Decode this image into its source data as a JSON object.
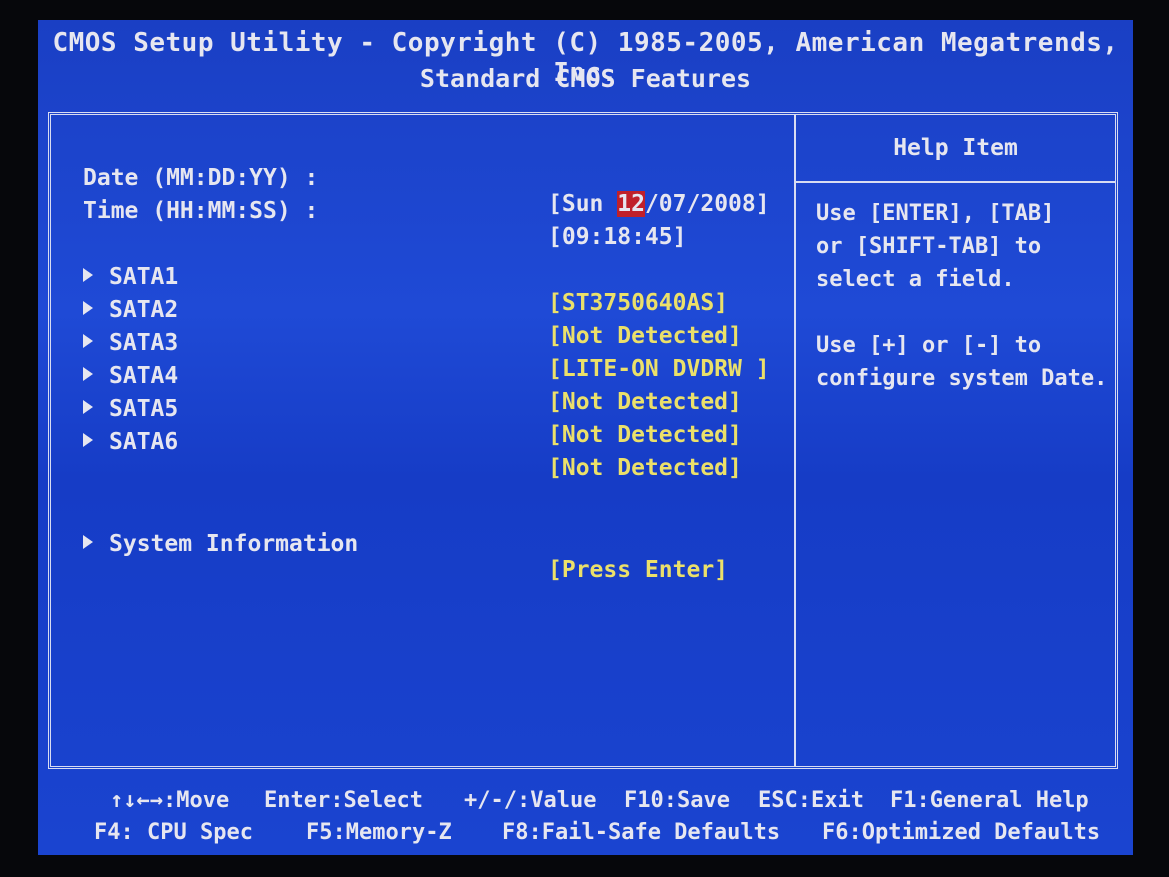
{
  "header": {
    "title": "CMOS Setup Utility - Copyright (C) 1985-2005, American Megatrends, Inc.",
    "subtitle": "Standard CMOS Features"
  },
  "fields": {
    "date": {
      "label": "Date (MM:DD:YY) :",
      "prefix": "[Sun ",
      "selected": "12",
      "suffix": "/07/2008]"
    },
    "time": {
      "label": "Time (HH:MM:SS) :",
      "value": "[09:18:45]"
    },
    "sata": [
      {
        "label": "SATA1",
        "value": "[ST3750640AS]"
      },
      {
        "label": "SATA2",
        "value": "[Not Detected]"
      },
      {
        "label": "SATA3",
        "value": "[LITE-ON DVDRW ]"
      },
      {
        "label": "SATA4",
        "value": "[Not Detected]"
      },
      {
        "label": "SATA5",
        "value": "[Not Detected]"
      },
      {
        "label": "SATA6",
        "value": "[Not Detected]"
      }
    ],
    "system_info": {
      "label": "System Information",
      "value": "[Press Enter]"
    }
  },
  "help": {
    "title": "Help Item",
    "lines1": [
      "Use [ENTER], [TAB]",
      "or [SHIFT-TAB] to",
      "select a field."
    ],
    "lines2": [
      "Use [+] or [-] to",
      "configure system Date."
    ]
  },
  "footer": {
    "move": "↑↓←→:Move",
    "select": "Enter:Select",
    "value": "+/-/:Value",
    "save": "F10:Save",
    "exit": "ESC:Exit",
    "help": "F1:General Help",
    "cpu": "F4: CPU Spec",
    "memory": "F5:Memory-Z",
    "failsafe": "F8:Fail-Safe Defaults",
    "optimized": "F6:Optimized Defaults"
  },
  "colors": {
    "background": "#1a44d0",
    "text": "#e6e6f0",
    "value_text": "#ebe06a",
    "highlight": "#c0202a"
  }
}
